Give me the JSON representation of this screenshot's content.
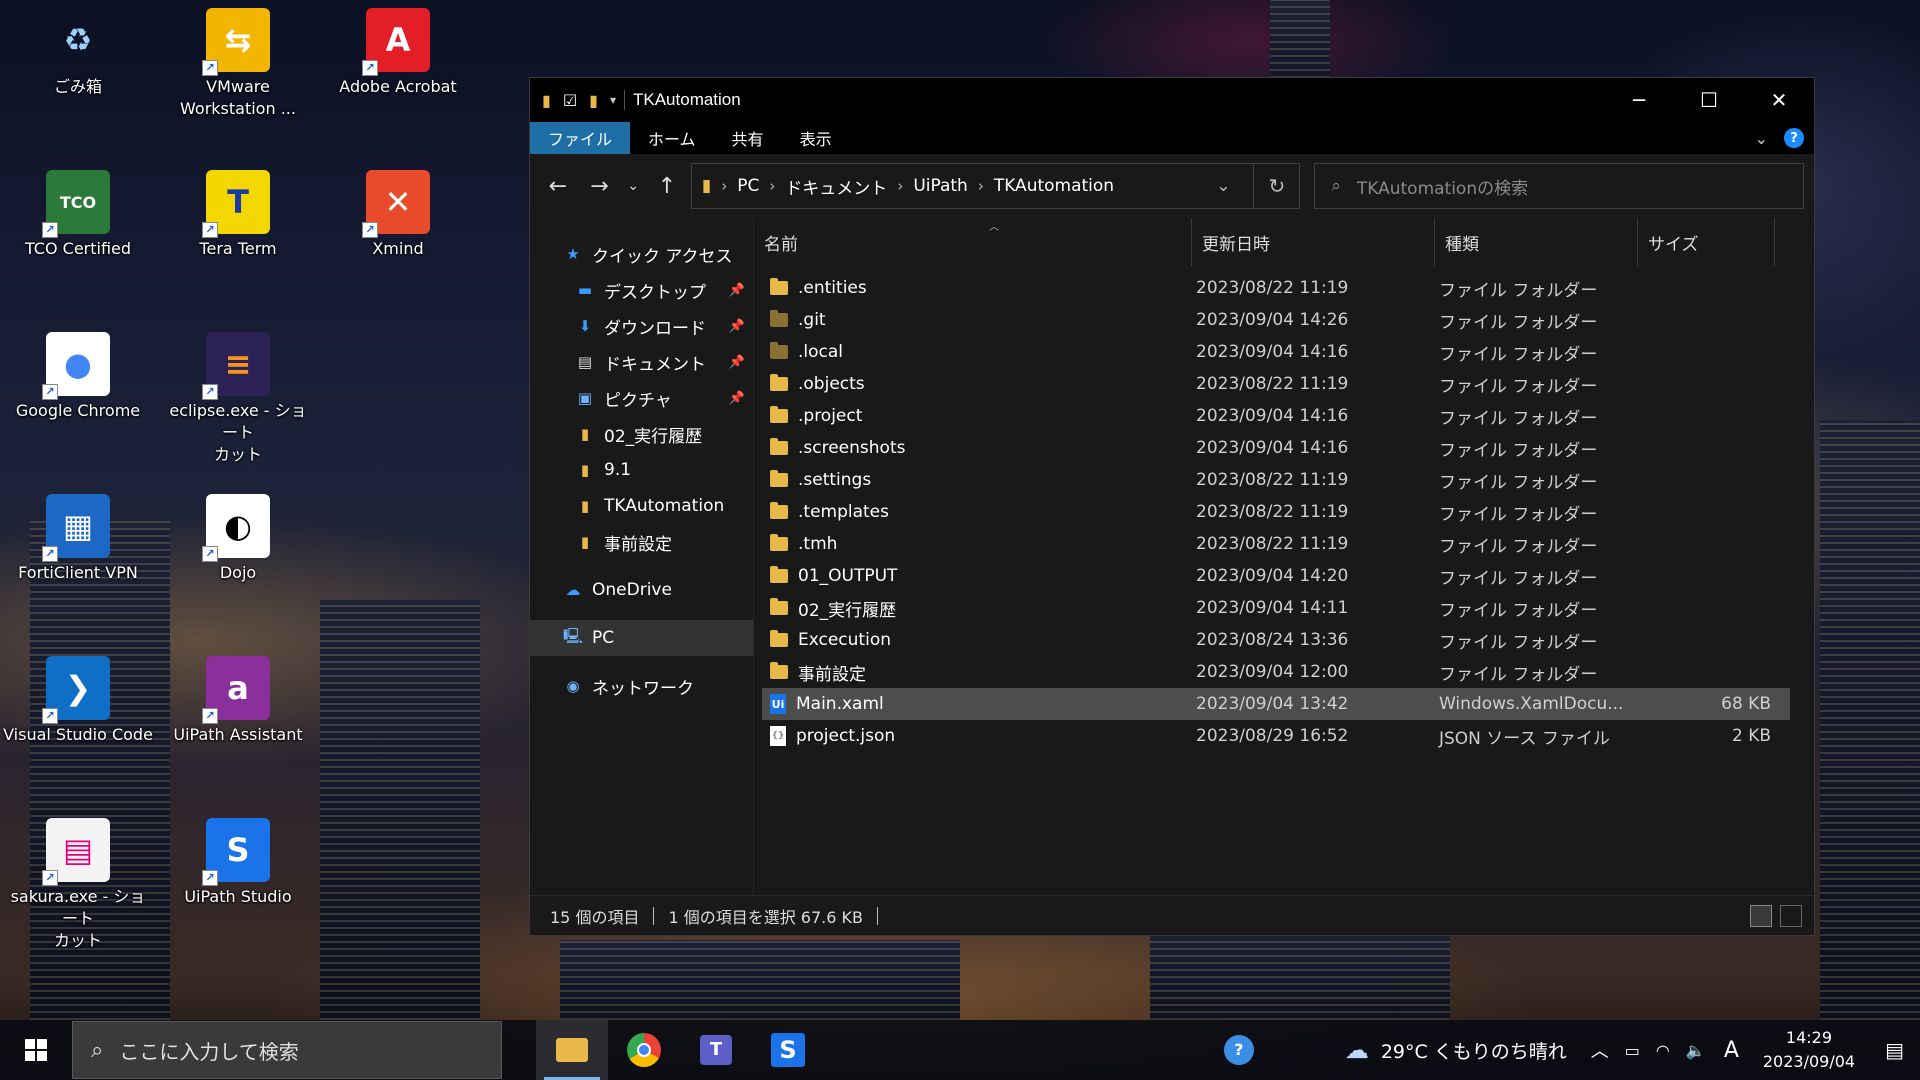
{
  "desktop": {
    "icons": [
      {
        "label": "ごみ箱"
      },
      {
        "label": "VMware\nWorkstation ..."
      },
      {
        "label": "Adobe Acrobat"
      },
      {
        "label": "TCO Certified"
      },
      {
        "label": "Tera Term"
      },
      {
        "label": "Xmind"
      },
      {
        "label": "Google Chrome"
      },
      {
        "label": "eclipse.exe - ショート\nカット"
      },
      {
        "label": "FortiClient VPN"
      },
      {
        "label": "Dojo"
      },
      {
        "label": "Visual Studio Code"
      },
      {
        "label": "UiPath Assistant"
      },
      {
        "label": "sakura.exe - ショート\nカット"
      },
      {
        "label": "UiPath Studio"
      }
    ]
  },
  "explorer": {
    "title": "TKAutomation",
    "ribbon_tabs": [
      "ファイル",
      "ホーム",
      "共有",
      "表示"
    ],
    "breadcrumb": [
      "PC",
      "ドキュメント",
      "UiPath",
      "TKAutomation"
    ],
    "search_placeholder": "TKAutomationの検索",
    "nav": {
      "quick_access": "クイック アクセス",
      "items": [
        "デスクトップ",
        "ダウンロード",
        "ドキュメント",
        "ピクチャ",
        "02_実行履歴",
        "9.1",
        "TKAutomation",
        "事前設定"
      ],
      "onedrive": "OneDrive",
      "pc": "PC",
      "network": "ネットワーク"
    },
    "columns": {
      "name": "名前",
      "date": "更新日時",
      "type": "種類",
      "size": "サイズ"
    },
    "files": [
      {
        "name": ".entities",
        "date": "2023/08/22 11:19",
        "type": "ファイル フォルダー",
        "size": ""
      },
      {
        "name": ".git",
        "date": "2023/09/04 14:26",
        "type": "ファイル フォルダー",
        "size": ""
      },
      {
        "name": ".local",
        "date": "2023/09/04 14:16",
        "type": "ファイル フォルダー",
        "size": ""
      },
      {
        "name": ".objects",
        "date": "2023/08/22 11:19",
        "type": "ファイル フォルダー",
        "size": ""
      },
      {
        "name": ".project",
        "date": "2023/09/04 14:16",
        "type": "ファイル フォルダー",
        "size": ""
      },
      {
        "name": ".screenshots",
        "date": "2023/09/04 14:16",
        "type": "ファイル フォルダー",
        "size": ""
      },
      {
        "name": ".settings",
        "date": "2023/08/22 11:19",
        "type": "ファイル フォルダー",
        "size": ""
      },
      {
        "name": ".templates",
        "date": "2023/08/22 11:19",
        "type": "ファイル フォルダー",
        "size": ""
      },
      {
        "name": ".tmh",
        "date": "2023/08/22 11:19",
        "type": "ファイル フォルダー",
        "size": ""
      },
      {
        "name": "01_OUTPUT",
        "date": "2023/09/04 14:20",
        "type": "ファイル フォルダー",
        "size": ""
      },
      {
        "name": "02_実行履歴",
        "date": "2023/09/04 14:11",
        "type": "ファイル フォルダー",
        "size": ""
      },
      {
        "name": "Excecution",
        "date": "2023/08/24 13:36",
        "type": "ファイル フォルダー",
        "size": ""
      },
      {
        "name": "事前設定",
        "date": "2023/09/04 12:00",
        "type": "ファイル フォルダー",
        "size": ""
      },
      {
        "name": "Main.xaml",
        "date": "2023/09/04 13:42",
        "type": "Windows.XamlDocu...",
        "size": "68 KB"
      },
      {
        "name": "project.json",
        "date": "2023/08/29 16:52",
        "type": "JSON ソース ファイル",
        "size": "2 KB"
      }
    ],
    "status": {
      "count": "15 個の項目",
      "selection": "1 個の項目を選択  67.6 KB"
    }
  },
  "taskbar": {
    "search_placeholder": "ここに入力して検索",
    "weather": "29°C  くもりのち晴れ",
    "ime": "A",
    "time": "14:29",
    "date": "2023/09/04"
  },
  "colors": {
    "accent": "#1d6fa5",
    "folder": "#e8b84a",
    "selection": "#4d4d4d"
  }
}
